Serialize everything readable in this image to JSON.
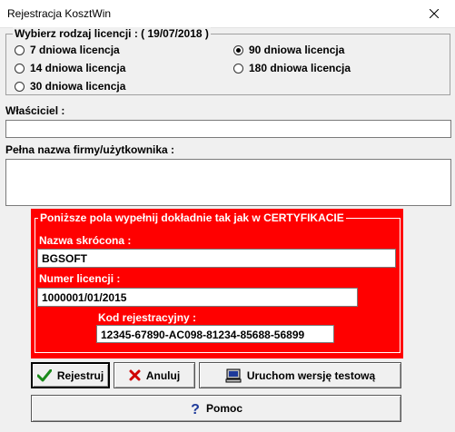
{
  "window": {
    "title": "Rejestracja KosztWin"
  },
  "license_group": {
    "legend": "Wybierz rodzaj licencji : ( 19/07/2018 )",
    "options": [
      {
        "label": "7 dniowa licencja",
        "checked": false
      },
      {
        "label": "14 dniowa licencja",
        "checked": false
      },
      {
        "label": "30 dniowa licencja",
        "checked": false
      },
      {
        "label": "90 dniowa licencja",
        "checked": true
      },
      {
        "label": "180 dniowa licencja",
        "checked": false
      }
    ]
  },
  "owner": {
    "label": "Właściciel :",
    "value": ""
  },
  "company": {
    "label": "Pełna nazwa firmy/użytkownika :",
    "value": ""
  },
  "certificate": {
    "legend": "Poniższe pola wypełnij dokładnie tak jak w CERTYFIKACIE",
    "short_name_label": "Nazwa skrócona :",
    "short_name_value": "BGSOFT",
    "license_number_label": "Numer licencji :",
    "license_number_value": "1000001/01/2015",
    "reg_code_label": "Kod rejestracyjny :",
    "reg_code_value": "12345-67890-AC098-81234-85688-56899",
    "color": "#ff0000"
  },
  "buttons": {
    "register": "Rejestruj",
    "cancel": "Anuluj",
    "test_version": "Uruchom wersję testową",
    "help": "Pomoc"
  }
}
